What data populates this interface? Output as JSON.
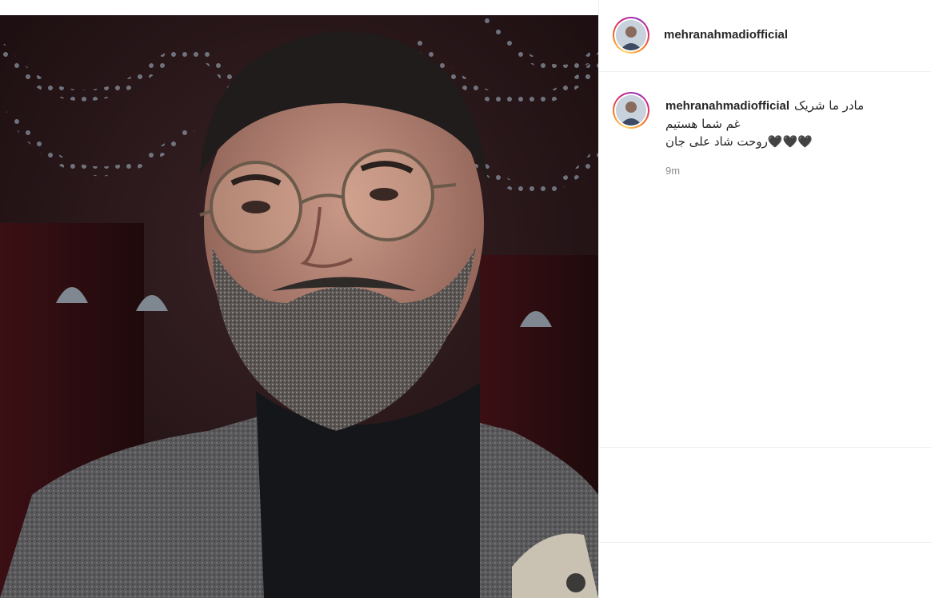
{
  "post": {
    "username": "mehranahmadiofficial",
    "image_alt": "Photo of a bearded man with round glasses",
    "caption": {
      "line1": "مادر ما شریک",
      "line2": "غم شما هستیم",
      "line3": "روحت شاد علی جان",
      "hearts": "🖤🖤🖤"
    },
    "time_ago": "9m"
  },
  "icons": {
    "header_avatar": "profile-avatar",
    "comment_avatar": "profile-avatar"
  },
  "colors": {
    "story_ring_start": "#feda75",
    "story_ring_mid": "#d62976",
    "story_ring_end": "#962fbf",
    "text_primary": "#262626",
    "text_secondary": "#8e8e8e",
    "divider": "#efefef"
  }
}
